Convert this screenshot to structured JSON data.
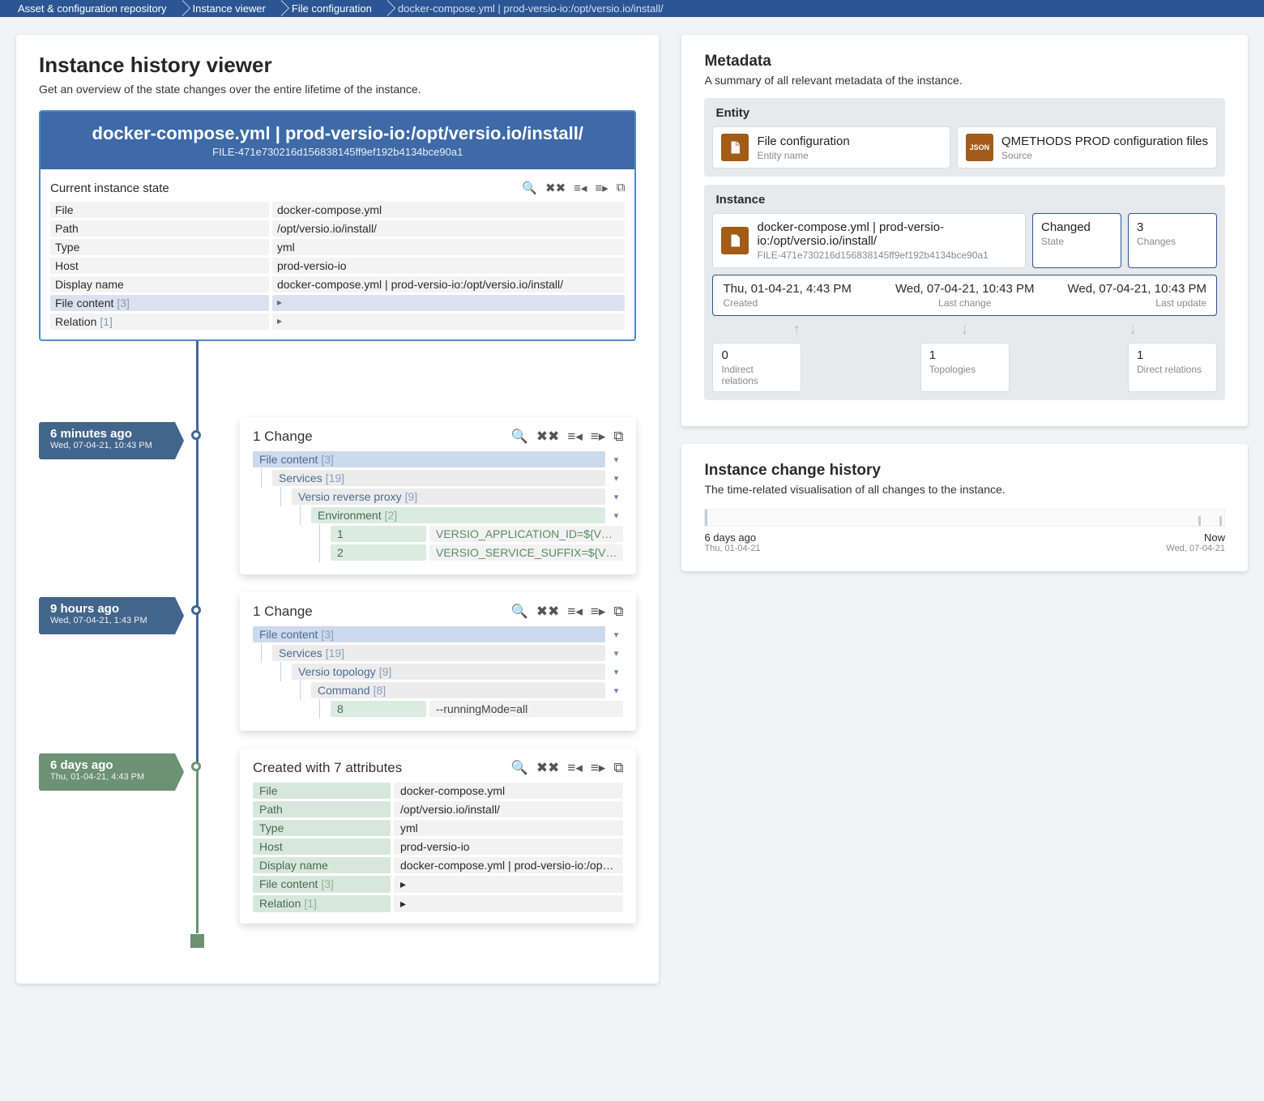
{
  "breadcrumb": [
    "Asset & configuration repository",
    "Instance viewer",
    "File configuration",
    "docker-compose.yml | prod-versio-io:/opt/versio.io/install/"
  ],
  "left": {
    "title": "Instance history viewer",
    "subtitle": "Get an overview of the state changes over the entire lifetime of the instance.",
    "header": {
      "title": "docker-compose.yml | prod-versio-io:/opt/versio.io/install/",
      "id": "FILE-471e730216d156838145ff9ef192b4134bce90a1",
      "section": "Current instance state",
      "rows": [
        {
          "k": "File",
          "v": "docker-compose.yml"
        },
        {
          "k": "Path",
          "v": "/opt/versio.io/install/"
        },
        {
          "k": "Type",
          "v": "yml"
        },
        {
          "k": "Host",
          "v": "prod-versio-io"
        },
        {
          "k": "Display name",
          "v": "docker-compose.yml | prod-versio-io:/opt/versio.io/install/"
        }
      ],
      "exp": [
        {
          "k": "File content",
          "c": "[3]"
        },
        {
          "k": "Relation",
          "c": "[1]"
        }
      ]
    },
    "entries": [
      {
        "tag": {
          "big": "6 minutes ago",
          "small": "Wed, 07-04-21, 10:43 PM",
          "kind": "steel"
        },
        "title": "1 Change",
        "tree": [
          {
            "ind": 0,
            "lbl": "File content",
            "cnt": "[3]",
            "bg": "bg-blue",
            "dd": true
          },
          {
            "ind": 1,
            "lbl": "Services",
            "cnt": "[19]",
            "bg": "bg-grey",
            "dd": true
          },
          {
            "ind": 2,
            "lbl": "Versio reverse proxy",
            "cnt": "[9]",
            "bg": "bg-grey",
            "dd": true
          },
          {
            "ind": 3,
            "lbl": "Environment",
            "cnt": "[2]",
            "bg": "bg-green",
            "dd": true
          }
        ],
        "kvs": [
          {
            "k": "1",
            "v": "VERSIO_APPLICATION_ID=${V…"
          },
          {
            "k": "2",
            "v": "VERSIO_SERVICE_SUFFIX=${V…"
          }
        ]
      },
      {
        "tag": {
          "big": "9 hours ago",
          "small": "Wed, 07-04-21, 1:43 PM",
          "kind": "steel"
        },
        "title": "1 Change",
        "tree": [
          {
            "ind": 0,
            "lbl": "File content",
            "cnt": "[3]",
            "bg": "bg-blue",
            "dd": true
          },
          {
            "ind": 1,
            "lbl": "Services",
            "cnt": "[19]",
            "bg": "bg-grey",
            "dd": true
          },
          {
            "ind": 2,
            "lbl": "Versio topology",
            "cnt": "[9]",
            "bg": "bg-grey",
            "dd": true
          },
          {
            "ind": 3,
            "lbl": "Command",
            "cnt": "[8]",
            "bg": "bg-grey",
            "dd": true
          }
        ],
        "kvs": [
          {
            "k": "8",
            "v": "--runningMode=all"
          }
        ]
      }
    ],
    "created": {
      "tag": {
        "big": "6 days ago",
        "small": "Thu, 01-04-21, 4:43 PM"
      },
      "title": "Created with 7 attributes",
      "rows": [
        {
          "k": "File",
          "v": "docker-compose.yml"
        },
        {
          "k": "Path",
          "v": "/opt/versio.io/install/"
        },
        {
          "k": "Type",
          "v": "yml"
        },
        {
          "k": "Host",
          "v": "prod-versio-io"
        },
        {
          "k": "Display name",
          "v": "docker-compose.yml | prod-versio-io:/op…"
        },
        {
          "k": "File content",
          "c": "[3]",
          "caret": true
        },
        {
          "k": "Relation",
          "c": "[1]",
          "caret": true
        }
      ]
    }
  },
  "meta": {
    "title": "Metadata",
    "sub": "A summary of all relevant metadata of the instance.",
    "entity": {
      "title": "Entity",
      "items": [
        {
          "label": "File configuration",
          "sub": "Entity name",
          "icon": "file"
        },
        {
          "label": "QMETHODS PROD configuration files",
          "sub": "Source",
          "icon": "json"
        }
      ]
    },
    "instance": {
      "title": "Instance",
      "main": {
        "label": "docker-compose.yml | prod-versio-io:/opt/versio.io/install/",
        "sub": "FILE-471e730216d156838145ff9ef192b4134bce90a1"
      },
      "state": {
        "label": "Changed",
        "sub": "State"
      },
      "changes": {
        "label": "3",
        "sub": "Changes"
      },
      "dates": [
        {
          "v": "Thu, 01-04-21, 4:43 PM",
          "l": "Created"
        },
        {
          "v": "Wed, 07-04-21, 10:43 PM",
          "l": "Last change"
        },
        {
          "v": "Wed, 07-04-21, 10:43 PM",
          "l": "Last update"
        }
      ],
      "rel": [
        {
          "v": "0",
          "l": "Indirect relations"
        },
        {
          "v": "1",
          "l": "Topologies"
        },
        {
          "v": "1",
          "l": "Direct relations"
        }
      ]
    }
  },
  "history": {
    "title": "Instance change history",
    "sub": "The time-related visualisation of all changes to the instance.",
    "left": {
      "t": "6 days ago",
      "s": "Thu, 01-04-21"
    },
    "right": {
      "t": "Now",
      "s": "Wed, 07-04-21"
    }
  },
  "chart_data": {
    "type": "bar",
    "title": "Instance change history",
    "xrange": [
      "Thu, 01-04-21",
      "Wed, 07-04-21"
    ],
    "points": [
      {
        "x_norm": 0.0,
        "h": 1.0
      },
      {
        "x_norm": 0.95,
        "h": 0.6
      },
      {
        "x_norm": 0.99,
        "h": 0.6
      }
    ]
  }
}
